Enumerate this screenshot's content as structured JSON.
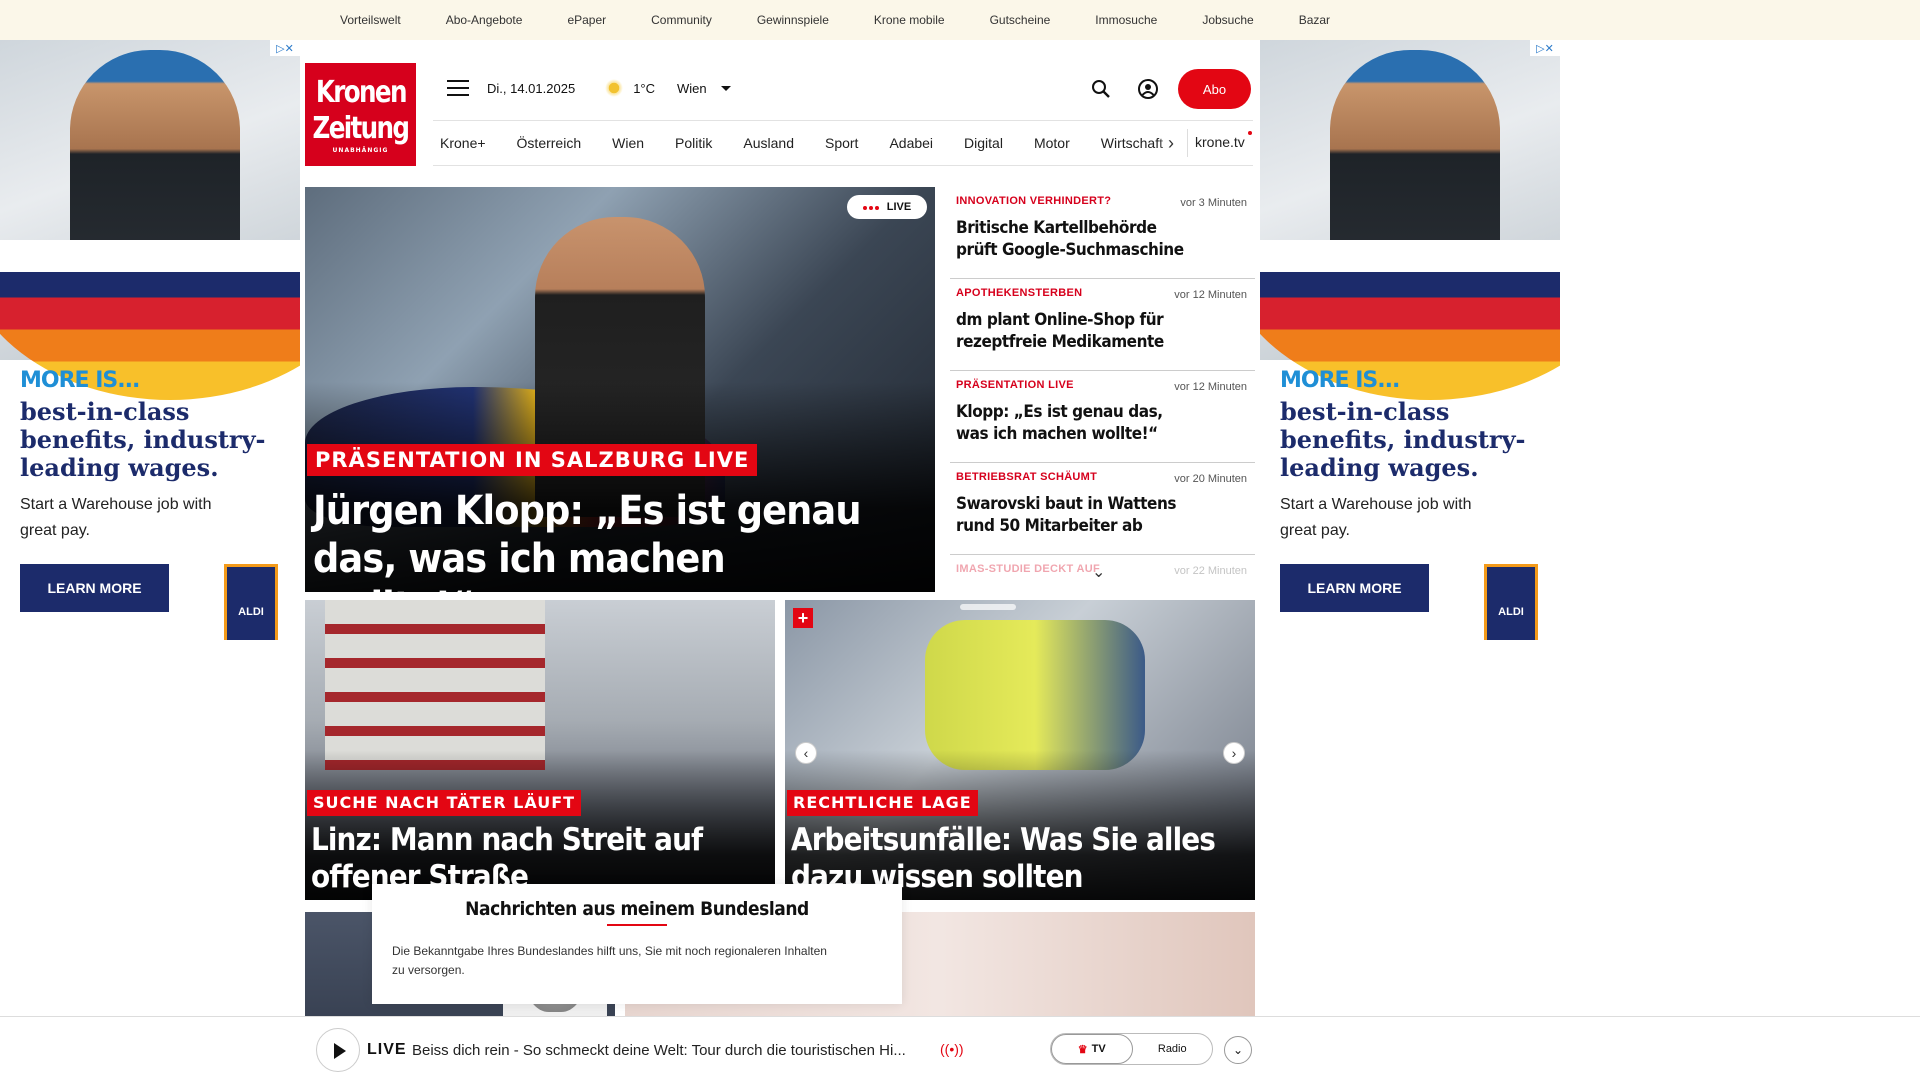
{
  "topnav": [
    "Vorteilswelt",
    "Abo-Angebote",
    "ePaper",
    "Community",
    "Gewinnspiele",
    "Krone mobile",
    "Gutscheine",
    "Immosuche",
    "Jobsuche",
    "Bazar"
  ],
  "ad": {
    "more": "MORE IS...",
    "headline": "best-in-class benefits, industry-leading wages.",
    "sub": "Start a Warehouse job with great pay.",
    "button": "LEARN MORE",
    "brand": "ALDI"
  },
  "logo": {
    "line1": "Kronen",
    "line2": "Zeitung",
    "tagline": "UNABHÄNGIG"
  },
  "header": {
    "date": "Di., 14.01.2025",
    "temp": "1°C",
    "city": "Wien",
    "abo": "Abo"
  },
  "nav": [
    "Krone+",
    "Österreich",
    "Wien",
    "Politik",
    "Ausland",
    "Sport",
    "Adabei",
    "Digital",
    "Motor",
    "Wirtschaft"
  ],
  "nav_extra": "krone.tv",
  "hero": {
    "live": "LIVE",
    "kicker": "PRÄSENTATION IN SALZBURG LIVE",
    "title": "Jürgen Klopp: „Es ist genau das, was ich machen wollte!“"
  },
  "news": [
    {
      "kicker": "INNOVATION VERHINDERT?",
      "time": "vor 3 Minuten",
      "title": "Britische Kartellbehörde prüft Google-Suchmaschine"
    },
    {
      "kicker": "APOTHEKENSTERBEN",
      "time": "vor 12 Minuten",
      "title": "dm plant Online-Shop für rezeptfreie Medikamente"
    },
    {
      "kicker": "PRÄSENTATION LIVE",
      "time": "vor 12 Minuten",
      "title": "Klopp: „Es ist genau das, was ich machen wollte!“"
    },
    {
      "kicker": "BETRIEBSRAT SCHÄUMT",
      "time": "vor 20 Minuten",
      "title": "Swarovski baut in Wattens rund 50 Mitarbeiter ab"
    },
    {
      "kicker": "IMAS-STUDIE DECKT AUF",
      "time": "vor 22 Minuten",
      "title": ""
    }
  ],
  "card1": {
    "kicker": "SUCHE NACH TÄTER LÄUFT",
    "title": "Linz: Mann nach Streit auf offener Straße angeschossen"
  },
  "card2": {
    "kicker": "RECHTLICHE LAGE",
    "title": "Arbeitsunfälle: Was Sie alles dazu wissen sollten"
  },
  "bundesland": {
    "title": "Nachrichten aus meinem Bundesland",
    "text": "Die Bekanntgabe Ihres Bundeslandes hilft uns, Sie mit noch regionaleren Inhalten zu versorgen."
  },
  "player": {
    "live": "LIVE",
    "title": "Beiss dich rein - So schmeckt deine Welt: Tour durch die touristischen Hi...",
    "tv": "TV",
    "radio": "Radio"
  }
}
